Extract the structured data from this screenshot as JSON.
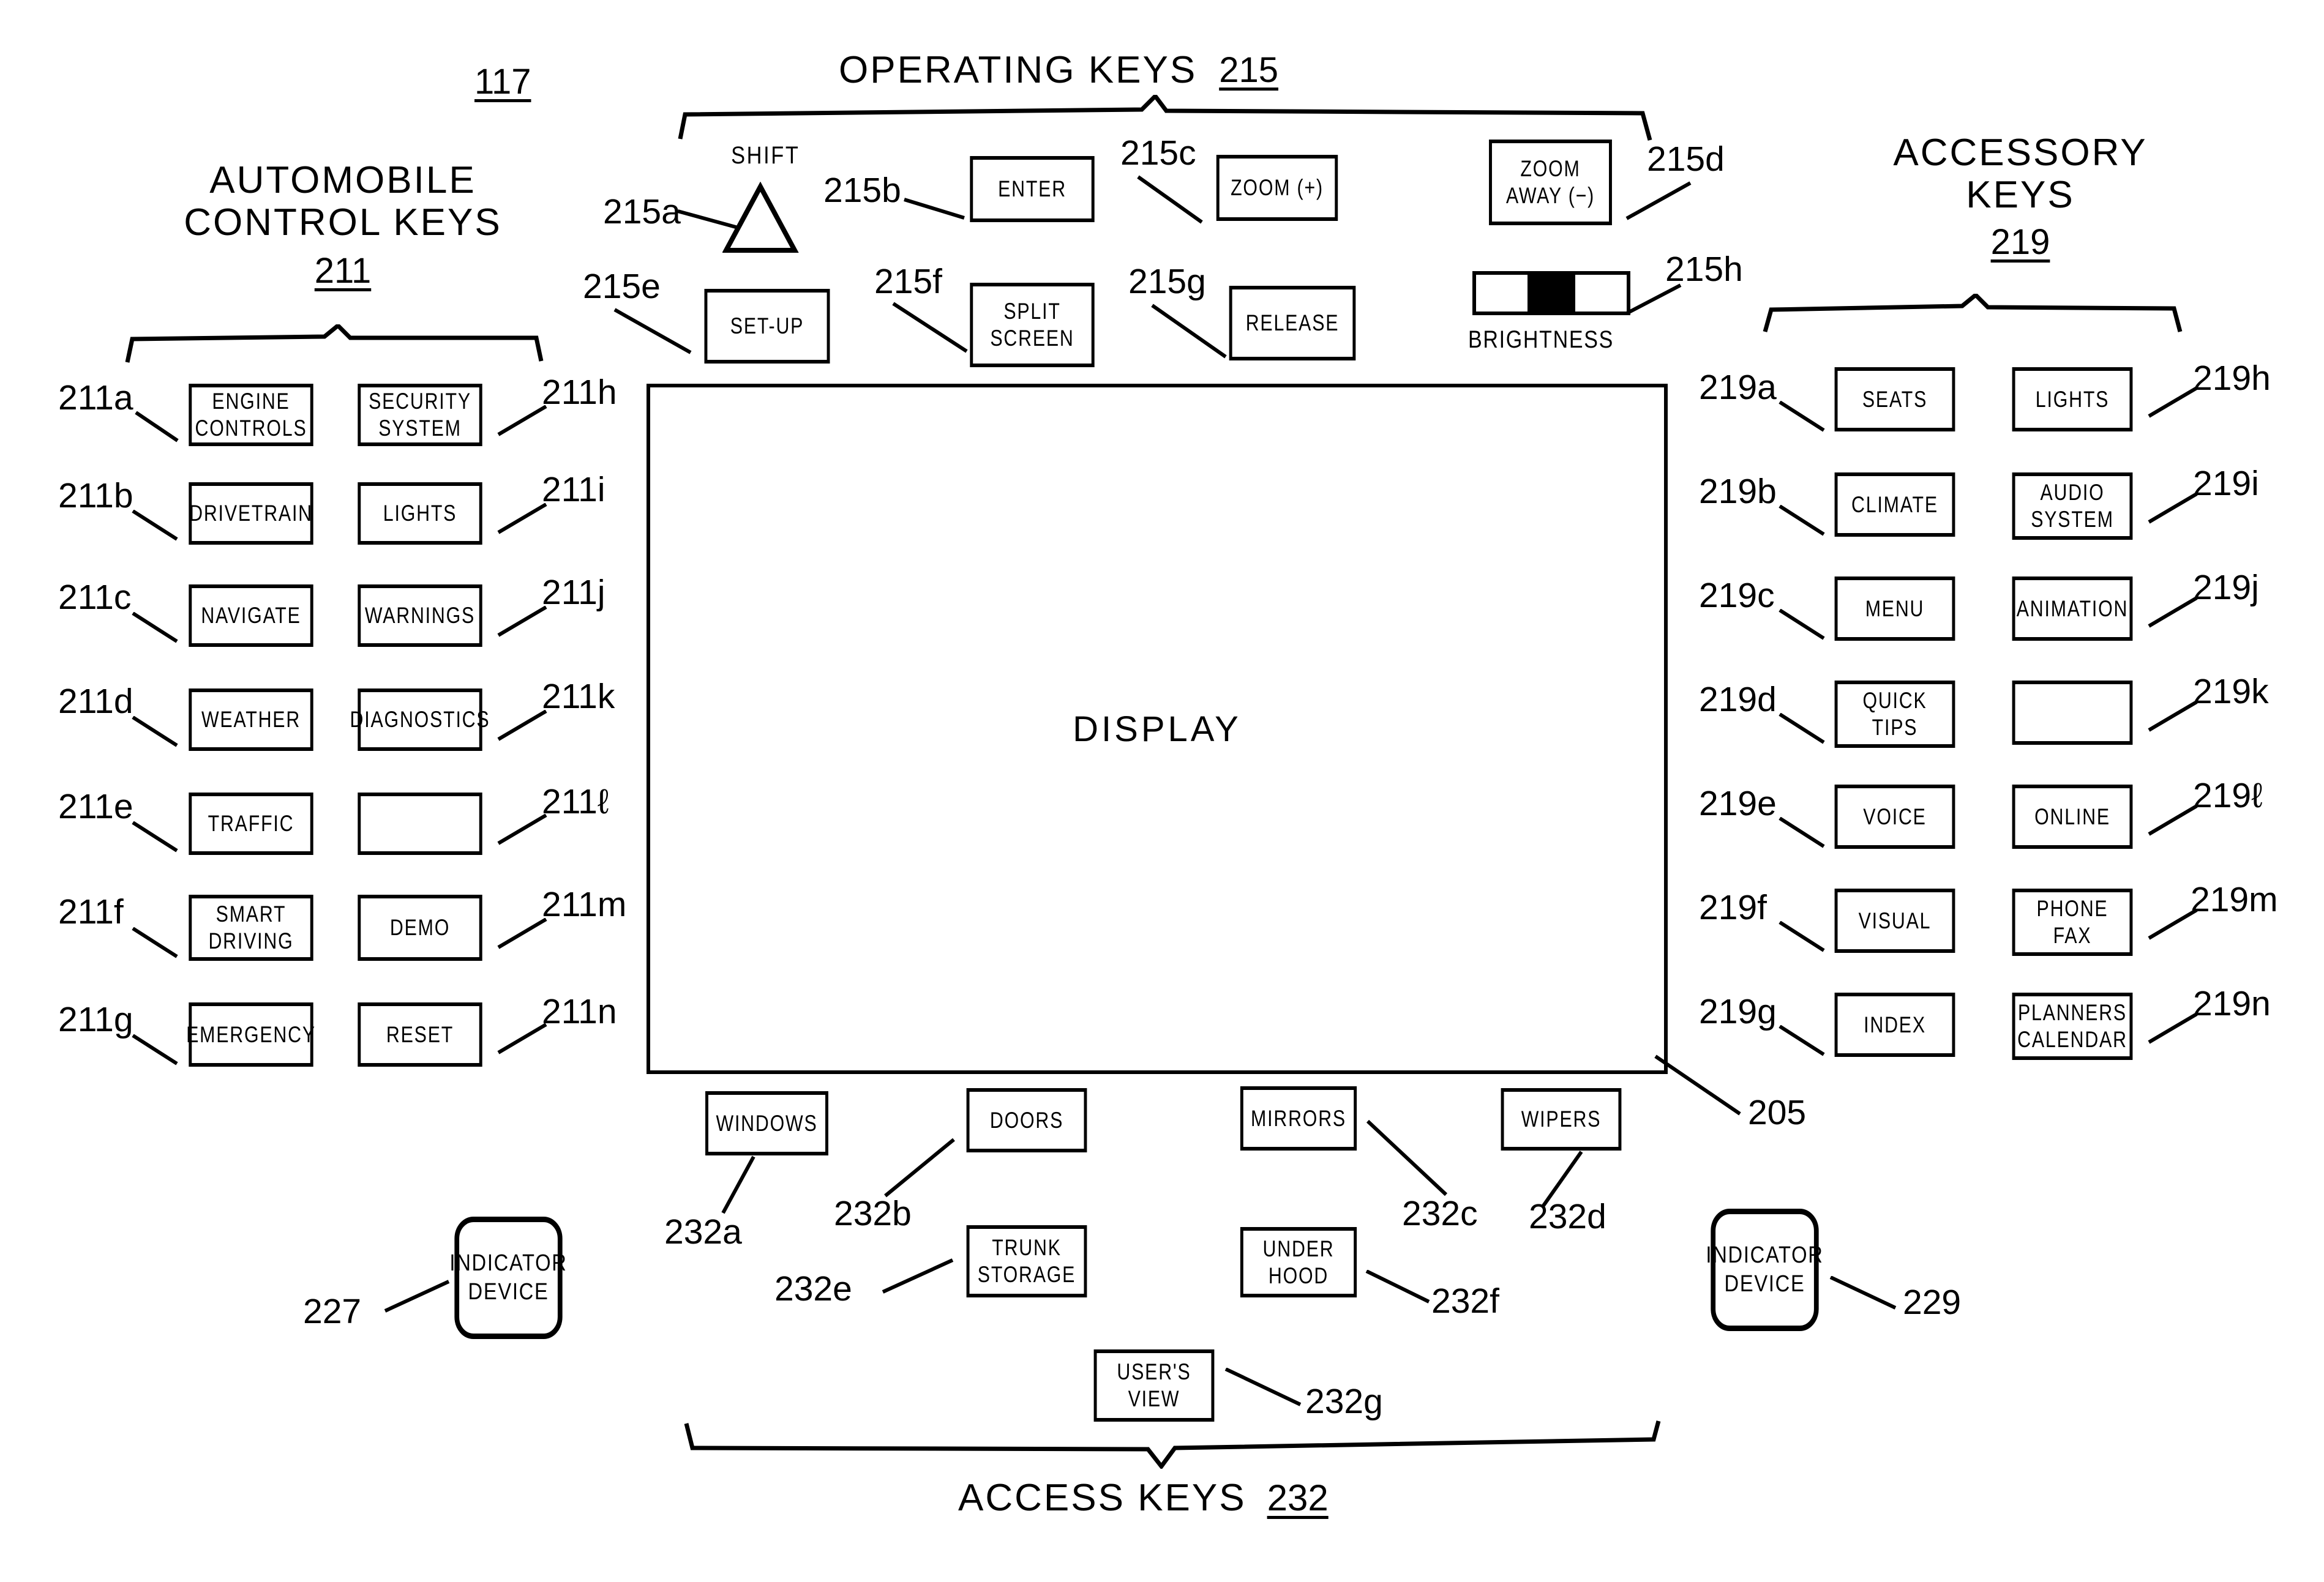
{
  "figure": {
    "top_ref": "117",
    "display_label": "DISPLAY",
    "display_ref": "205"
  },
  "automobile_control_keys": {
    "title_line1": "AUTOMOBILE",
    "title_line2": "CONTROL KEYS",
    "group_ref": "211",
    "left_column": [
      {
        "ref": "211a",
        "label": "ENGINE\nCONTROLS"
      },
      {
        "ref": "211b",
        "label": "DRIVETRAIN"
      },
      {
        "ref": "211c",
        "label": "NAVIGATE"
      },
      {
        "ref": "211d",
        "label": "WEATHER"
      },
      {
        "ref": "211e",
        "label": "TRAFFIC"
      },
      {
        "ref": "211f",
        "label": "SMART\nDRIVING"
      },
      {
        "ref": "211g",
        "label": "EMERGENCY"
      }
    ],
    "right_column": [
      {
        "ref": "211h",
        "label": "SECURITY\nSYSTEM"
      },
      {
        "ref": "211i",
        "label": "LIGHTS"
      },
      {
        "ref": "211j",
        "label": "WARNINGS"
      },
      {
        "ref": "211k",
        "label": "DIAGNOSTICS"
      },
      {
        "ref": "211ℓ",
        "label": ""
      },
      {
        "ref": "211m",
        "label": "DEMO"
      },
      {
        "ref": "211n",
        "label": "RESET"
      }
    ]
  },
  "operating_keys": {
    "title": "OPERATING KEYS",
    "group_ref": "215",
    "shift_caption": "SHIFT",
    "row1": [
      {
        "ref": "215a",
        "label": "",
        "type": "triangle"
      },
      {
        "ref": "215b",
        "label": "ENTER",
        "type": "key"
      },
      {
        "ref": "215c",
        "label": "ZOOM (+)",
        "type": "key"
      },
      {
        "ref": "215d",
        "label": "ZOOM\nAWAY (−)",
        "type": "key"
      }
    ],
    "row2": [
      {
        "ref": "215e",
        "label": "SET-UP",
        "type": "key"
      },
      {
        "ref": "215f",
        "label": "SPLIT\nSCREEN",
        "type": "key"
      },
      {
        "ref": "215g",
        "label": "RELEASE",
        "type": "key"
      },
      {
        "ref": "215h",
        "label": "BRIGHTNESS",
        "type": "slider"
      }
    ]
  },
  "accessory_keys": {
    "title_line1": "ACCESSORY",
    "title_line2": "KEYS",
    "group_ref": "219",
    "left_column": [
      {
        "ref": "219a",
        "label": "SEATS"
      },
      {
        "ref": "219b",
        "label": "CLIMATE"
      },
      {
        "ref": "219c",
        "label": "MENU"
      },
      {
        "ref": "219d",
        "label": "QUICK\nTIPS"
      },
      {
        "ref": "219e",
        "label": "VOICE"
      },
      {
        "ref": "219f",
        "label": "VISUAL"
      },
      {
        "ref": "219g",
        "label": "INDEX"
      }
    ],
    "right_column": [
      {
        "ref": "219h",
        "label": "LIGHTS"
      },
      {
        "ref": "219i",
        "label": "AUDIO\nSYSTEM"
      },
      {
        "ref": "219j",
        "label": "ANIMATION"
      },
      {
        "ref": "219k",
        "label": ""
      },
      {
        "ref": "219ℓ",
        "label": "ONLINE"
      },
      {
        "ref": "219m",
        "label": "PHONE\nFAX"
      },
      {
        "ref": "219n",
        "label": "PLANNERS\nCALENDAR"
      }
    ]
  },
  "access_keys": {
    "caption": "ACCESS KEYS",
    "group_ref": "232",
    "items": [
      {
        "ref": "232a",
        "label": "WINDOWS"
      },
      {
        "ref": "232b",
        "label": "DOORS"
      },
      {
        "ref": "232c",
        "label": "MIRRORS"
      },
      {
        "ref": "232d",
        "label": "WIPERS"
      },
      {
        "ref": "232e",
        "label": "TRUNK\nSTORAGE"
      },
      {
        "ref": "232f",
        "label": "UNDER\nHOOD"
      },
      {
        "ref": "232g",
        "label": "USER'S\nVIEW"
      }
    ]
  },
  "indicators": [
    {
      "ref": "227",
      "label": "INDICATOR\nDEVICE"
    },
    {
      "ref": "229",
      "label": "INDICATOR\nDEVICE"
    }
  ],
  "colors": {
    "ink": "#000000",
    "paper": "#ffffff"
  }
}
